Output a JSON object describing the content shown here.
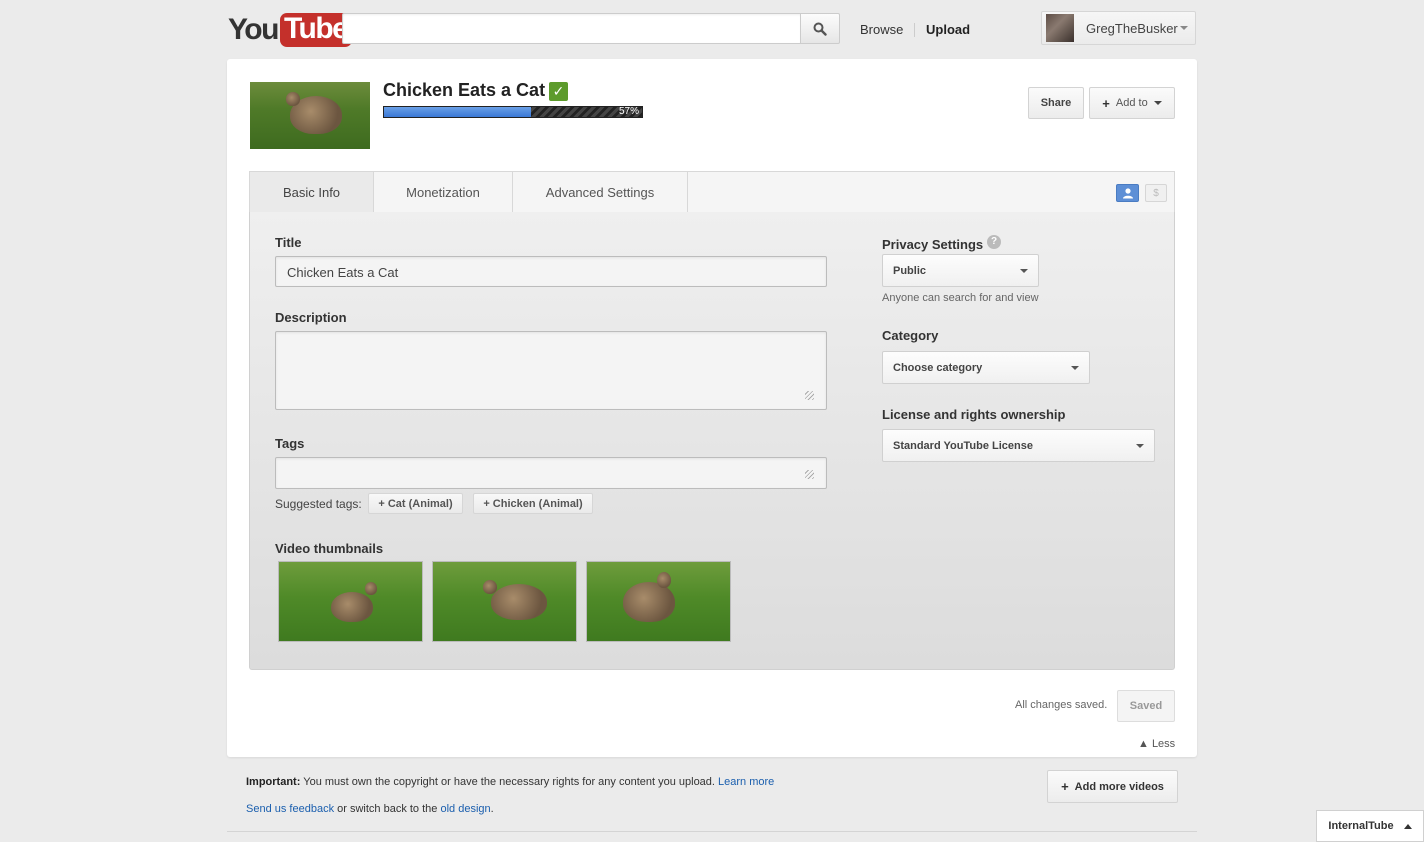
{
  "header": {
    "logo_you": "You",
    "logo_tube": "Tube",
    "search_value": "",
    "nav_browse": "Browse",
    "nav_upload": "Upload",
    "username": "GregTheBusker"
  },
  "video": {
    "title": "Chicken Eats a Cat",
    "upload_progress_percent": 57,
    "upload_progress_label": "57%",
    "share_label": "Share",
    "add_to_label": "Add to"
  },
  "tabs": [
    {
      "label": "Basic Info",
      "active": true
    },
    {
      "label": "Monetization",
      "active": false
    },
    {
      "label": "Advanced Settings",
      "active": false
    }
  ],
  "basic_info": {
    "title_label": "Title",
    "title_value": "Chicken Eats a Cat",
    "description_label": "Description",
    "description_value": "",
    "tags_label": "Tags",
    "tags_value": "",
    "suggested_tags_label": "Suggested tags:",
    "suggested_tags": [
      "+ Cat (Animal)",
      "+ Chicken (Animal)"
    ],
    "thumbnails_label": "Video thumbnails"
  },
  "settings": {
    "privacy_label": "Privacy Settings",
    "privacy_value": "Public",
    "privacy_hint": "Anyone can search for and view",
    "category_label": "Category",
    "category_value": "Choose category",
    "license_label": "License and rights ownership",
    "license_value": "Standard YouTube License"
  },
  "status": {
    "saved_text": "All changes saved.",
    "saved_button": "Saved",
    "less_label": "▲ Less"
  },
  "footer": {
    "important_bold": "Important:",
    "important_text": " You must own the copyright or have the necessary rights for any content you upload. ",
    "learn_more": "Learn more",
    "feedback_link": "Send us feedback",
    "switch_text": " or switch back to the ",
    "old_design_link": "old design",
    "period": ".",
    "add_more_videos": "Add more videos",
    "internaltube": "InternalTube"
  },
  "colors": {
    "progress_fill": "#3a78d6",
    "brand_red": "#c4302b",
    "check_green": "#5d9b2c",
    "link_blue": "#1b5fae"
  }
}
